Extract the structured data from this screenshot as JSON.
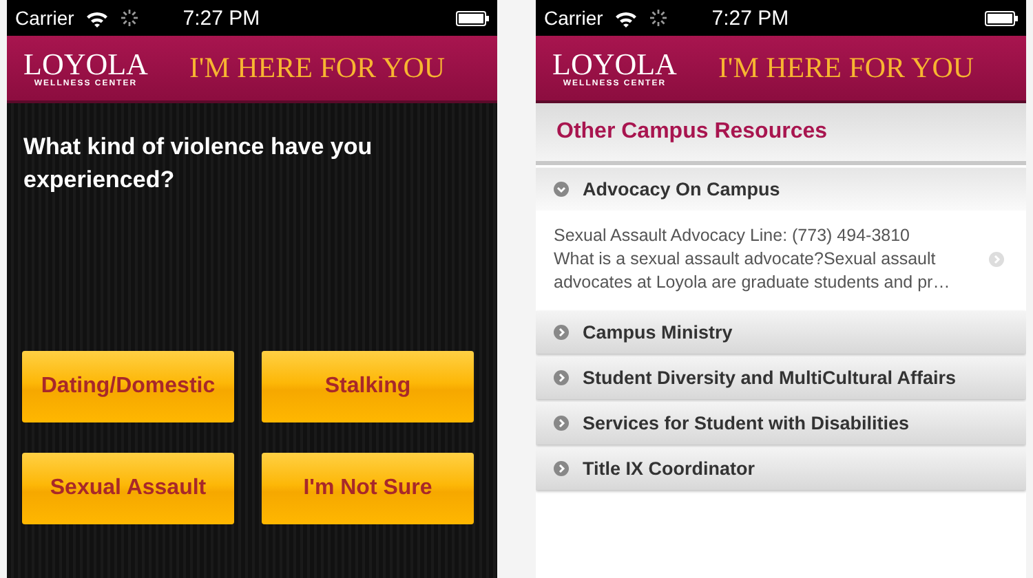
{
  "screens": [
    {
      "kind": "question",
      "status_bar": {
        "carrier": "Carrier",
        "time": "7:27 PM"
      },
      "header": {
        "logo": "LOYOLA",
        "logo_subtitle": "WELLNESS CENTER",
        "tagline": "I'M HERE FOR YOU"
      },
      "question": "What kind of violence have you experienced?",
      "buttons": [
        "Dating/Domestic",
        "Stalking",
        "Sexual Assault",
        "I'm Not Sure"
      ]
    },
    {
      "kind": "resources",
      "status_bar": {
        "carrier": "Carrier",
        "time": "7:27 PM"
      },
      "header": {
        "logo": "LOYOLA",
        "logo_subtitle": "WELLNESS CENTER",
        "tagline": "I'M HERE FOR YOU"
      },
      "section_title": "Other Campus Resources",
      "items": [
        {
          "title": "Advocacy On Campus",
          "expanded": true,
          "phone_line": "Sexual Assault Advocacy Line: (773) 494-3810",
          "description": "What is a sexual assault advocate?Sexual assault advocates at Loyola are graduate students and pr…"
        },
        {
          "title": "Campus Ministry",
          "expanded": false
        },
        {
          "title": "Student Diversity and MultiCultural Affairs",
          "expanded": false
        },
        {
          "title": "Services for Student with Disabilities",
          "expanded": false
        },
        {
          "title": "Title IX Coordinator",
          "expanded": false
        }
      ]
    }
  ]
}
